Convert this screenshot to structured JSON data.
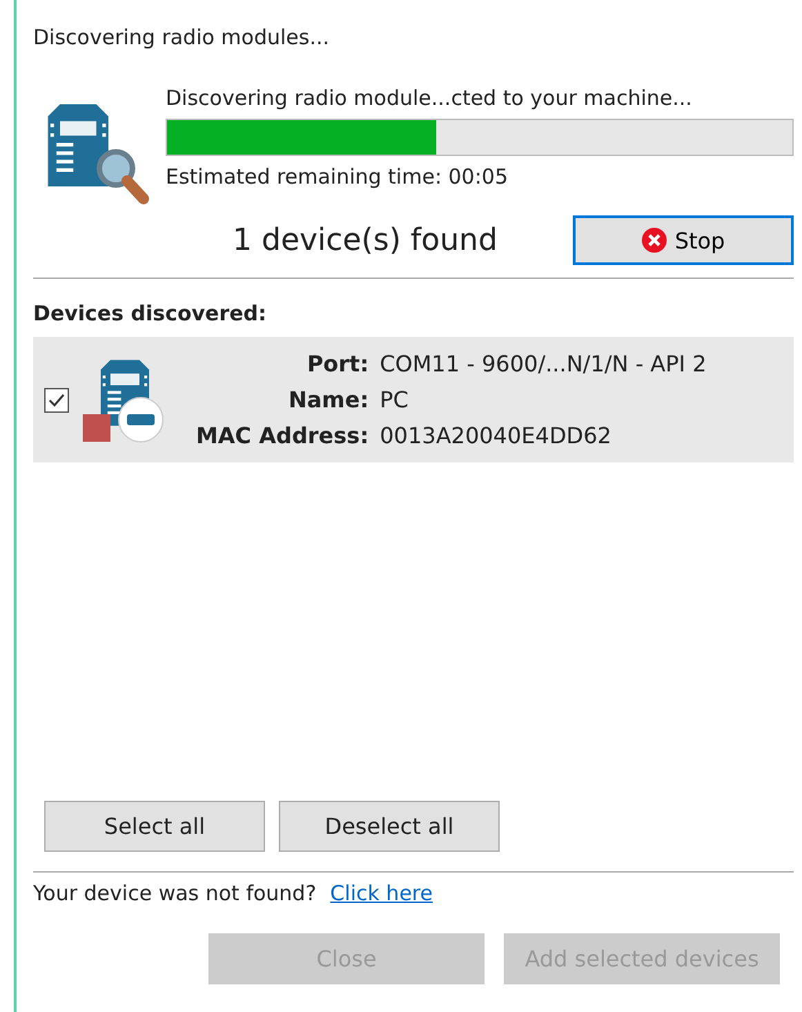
{
  "window": {
    "title": "Discovering radio modules..."
  },
  "progress": {
    "message": "Discovering radio module...cted to your machine...",
    "level": 0.43,
    "remaining": "Estimated remaining time: 00:05"
  },
  "found": "1 device(s) found",
  "stop_button": "Stop",
  "devices_heading": "Devices discovered:",
  "devices": [
    {
      "checked": true,
      "fields": [
        {
          "label": "Port:",
          "value": "COM11 - 9600/...N/1/N - API 2"
        },
        {
          "label": "Name:",
          "value": "PC"
        },
        {
          "label": "MAC Address:",
          "value": "0013A20040E4DD62"
        }
      ]
    }
  ],
  "selection_buttons": [
    "Select all",
    "Deselect all"
  ],
  "not_found": {
    "text": "Your device was not found?",
    "link": "Click here"
  },
  "footer_buttons": [
    {
      "label": "Close",
      "disabled": true
    },
    {
      "label": "Add selected devices",
      "disabled": true
    }
  ]
}
